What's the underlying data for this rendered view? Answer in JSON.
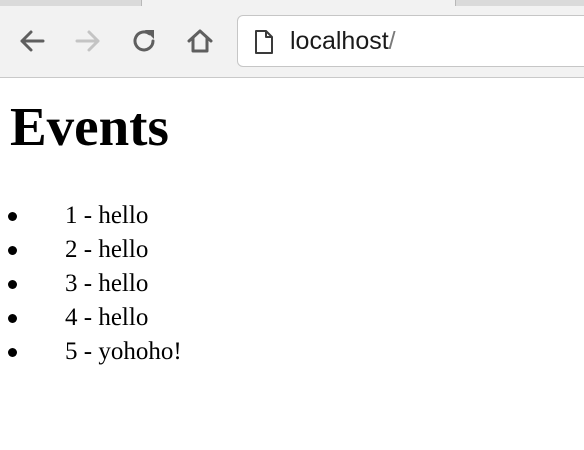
{
  "browser": {
    "url_host": "localhost",
    "url_path": "/"
  },
  "page": {
    "heading": "Events",
    "events": [
      "1 - hello",
      "2 - hello",
      "3 - hello",
      "4 - hello",
      "5 - yohoho!"
    ]
  }
}
